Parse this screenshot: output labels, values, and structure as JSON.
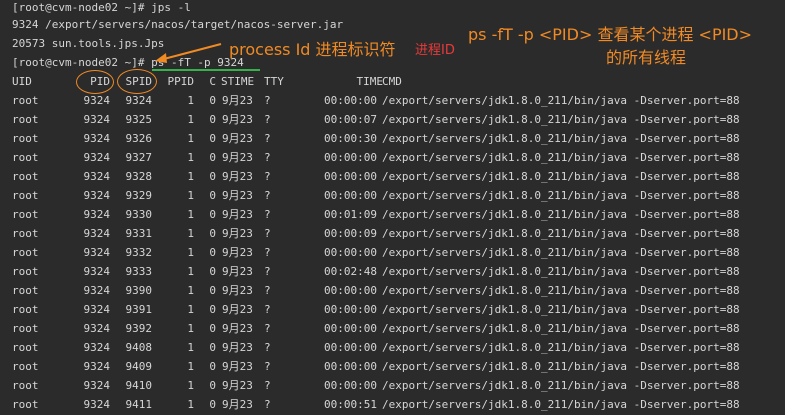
{
  "terminal": {
    "prompt": "[root@cvm-node02 ~]# ",
    "commands": {
      "jps": "jps -l",
      "ps": "ps -fT -p 9324"
    },
    "jps_output": [
      "9324 /export/servers/nacos/target/nacos-server.jar",
      "20573 sun.tools.jps.Jps"
    ]
  },
  "ps_table": {
    "columns": [
      "UID",
      "PID",
      "SPID",
      "PPID",
      "C",
      "STIME",
      "TTY",
      "TIME",
      "CMD"
    ],
    "rows": [
      [
        "root",
        "9324",
        "9324",
        "1",
        "0",
        "9月23",
        "?",
        "00:00:00",
        "/export/servers/jdk1.8.0_211/bin/java -Dserver.port=88"
      ],
      [
        "root",
        "9324",
        "9325",
        "1",
        "0",
        "9月23",
        "?",
        "00:00:07",
        "/export/servers/jdk1.8.0_211/bin/java -Dserver.port=88"
      ],
      [
        "root",
        "9324",
        "9326",
        "1",
        "0",
        "9月23",
        "?",
        "00:00:30",
        "/export/servers/jdk1.8.0_211/bin/java -Dserver.port=88"
      ],
      [
        "root",
        "9324",
        "9327",
        "1",
        "0",
        "9月23",
        "?",
        "00:00:00",
        "/export/servers/jdk1.8.0_211/bin/java -Dserver.port=88"
      ],
      [
        "root",
        "9324",
        "9328",
        "1",
        "0",
        "9月23",
        "?",
        "00:00:00",
        "/export/servers/jdk1.8.0_211/bin/java -Dserver.port=88"
      ],
      [
        "root",
        "9324",
        "9329",
        "1",
        "0",
        "9月23",
        "?",
        "00:00:00",
        "/export/servers/jdk1.8.0_211/bin/java -Dserver.port=88"
      ],
      [
        "root",
        "9324",
        "9330",
        "1",
        "0",
        "9月23",
        "?",
        "00:01:09",
        "/export/servers/jdk1.8.0_211/bin/java -Dserver.port=88"
      ],
      [
        "root",
        "9324",
        "9331",
        "1",
        "0",
        "9月23",
        "?",
        "00:00:09",
        "/export/servers/jdk1.8.0_211/bin/java -Dserver.port=88"
      ],
      [
        "root",
        "9324",
        "9332",
        "1",
        "0",
        "9月23",
        "?",
        "00:00:00",
        "/export/servers/jdk1.8.0_211/bin/java -Dserver.port=88"
      ],
      [
        "root",
        "9324",
        "9333",
        "1",
        "0",
        "9月23",
        "?",
        "00:02:48",
        "/export/servers/jdk1.8.0_211/bin/java -Dserver.port=88"
      ],
      [
        "root",
        "9324",
        "9390",
        "1",
        "0",
        "9月23",
        "?",
        "00:00:00",
        "/export/servers/jdk1.8.0_211/bin/java -Dserver.port=88"
      ],
      [
        "root",
        "9324",
        "9391",
        "1",
        "0",
        "9月23",
        "?",
        "00:00:00",
        "/export/servers/jdk1.8.0_211/bin/java -Dserver.port=88"
      ],
      [
        "root",
        "9324",
        "9392",
        "1",
        "0",
        "9月23",
        "?",
        "00:00:00",
        "/export/servers/jdk1.8.0_211/bin/java -Dserver.port=88"
      ],
      [
        "root",
        "9324",
        "9408",
        "1",
        "0",
        "9月23",
        "?",
        "00:00:00",
        "/export/servers/jdk1.8.0_211/bin/java -Dserver.port=88"
      ],
      [
        "root",
        "9324",
        "9409",
        "1",
        "0",
        "9月23",
        "?",
        "00:00:00",
        "/export/servers/jdk1.8.0_211/bin/java -Dserver.port=88"
      ],
      [
        "root",
        "9324",
        "9410",
        "1",
        "0",
        "9月23",
        "?",
        "00:00:00",
        "/export/servers/jdk1.8.0_211/bin/java -Dserver.port=88"
      ],
      [
        "root",
        "9324",
        "9411",
        "1",
        "0",
        "9月23",
        "?",
        "00:00:51",
        "/export/servers/jdk1.8.0_211/bin/java -Dserver.port=88"
      ]
    ]
  },
  "annotations": {
    "process_id_label": "process Id 进程标识符",
    "process_id_suffix": "进程ID",
    "command_note_line1": "ps -fT -p <PID> 查看某个进程 <PID>",
    "command_note_line2": "的所有线程"
  },
  "colors": {
    "background": "#2b2b2b",
    "text": "#d6d6d6",
    "annotation_orange": "#f08a24",
    "annotation_red": "#e83a3a",
    "underline_green": "#35b24a"
  }
}
